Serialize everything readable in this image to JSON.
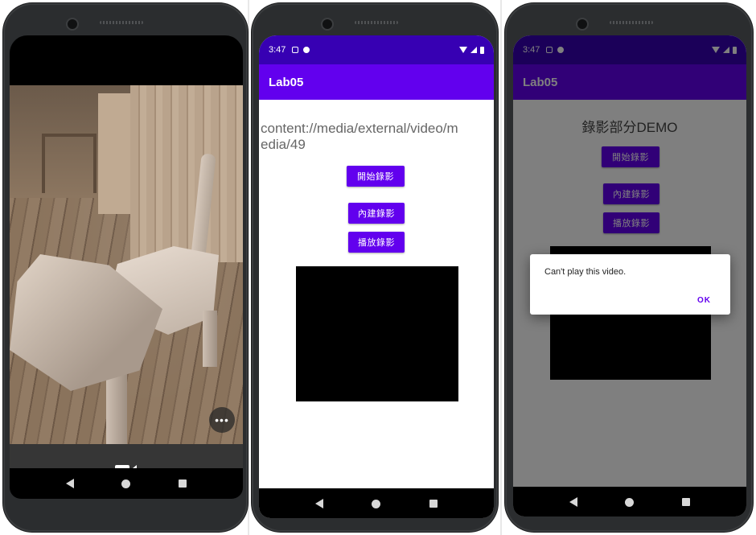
{
  "phone1": {
    "camera_controls": {
      "more_label": "•••",
      "record_icon": "video-camera-icon"
    }
  },
  "phone2": {
    "status": {
      "time": "3:47"
    },
    "app_title": "Lab05",
    "content_text": "content://media/external/video/media/49",
    "buttons": {
      "start_record": "開始錄影",
      "builtin_record": "內建錄影",
      "play_record": "播放錄影"
    }
  },
  "phone3": {
    "status": {
      "time": "3:47"
    },
    "app_title": "Lab05",
    "heading": "錄影部分DEMO",
    "buttons": {
      "start_record": "開始錄影",
      "builtin_record": "內建錄影",
      "play_record": "播放錄影"
    },
    "dialog": {
      "message": "Can't play this video.",
      "ok_label": "OK"
    }
  },
  "colors": {
    "primary": "#6200ee",
    "primary_dark": "#3700b3",
    "dim_primary": "#310077"
  }
}
